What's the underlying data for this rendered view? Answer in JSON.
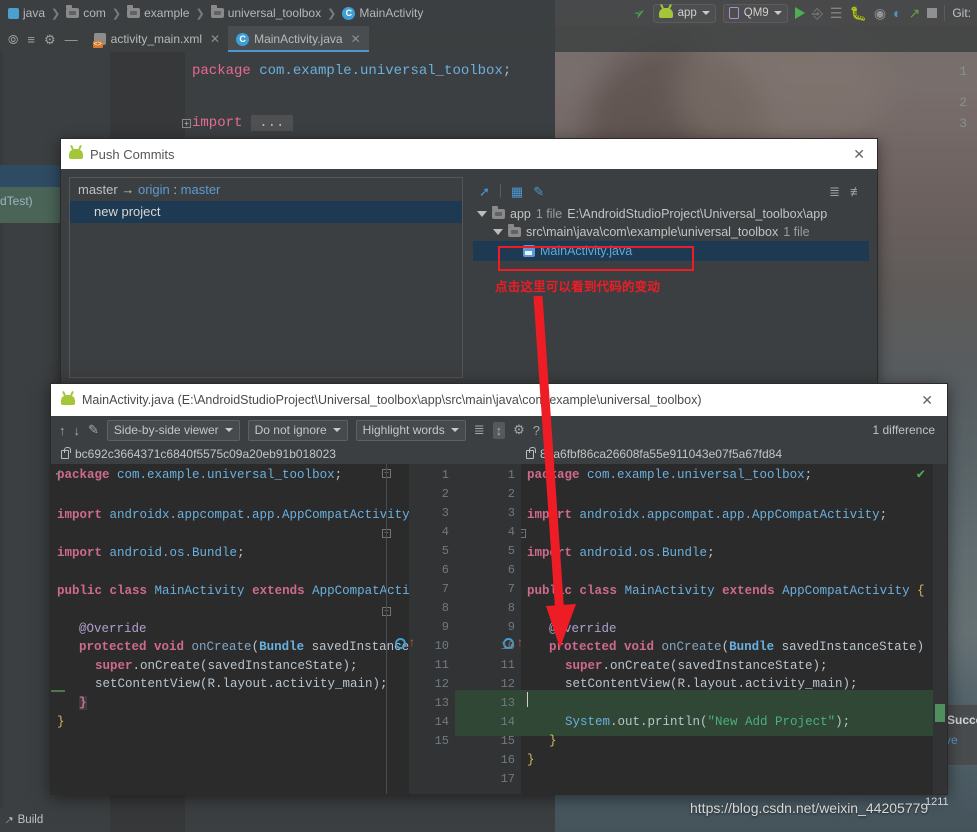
{
  "ide": {
    "breadcrumb": [
      {
        "label": "java",
        "icon": "folder-source-icon"
      },
      {
        "label": "com",
        "icon": "folder-icon"
      },
      {
        "label": "example",
        "icon": "folder-icon"
      },
      {
        "label": "universal_toolbox",
        "icon": "folder-icon"
      },
      {
        "label": "MainActivity",
        "icon": "class-icon"
      }
    ],
    "toolbar": {
      "module_selector": "app",
      "device_selector": "QM9",
      "git_label": "Git:",
      "icons": [
        "hammer-build-icon",
        "run-icon",
        "attach-debug-icon",
        "profile-list-icon",
        "debug-bug-icon",
        "run-coverage-icon",
        "profiler-icon",
        "sync-gradle-icon",
        "stop-icon"
      ]
    },
    "tabs": [
      {
        "label": "activity_main.xml",
        "icon": "xml-layout-icon",
        "active": false
      },
      {
        "label": "MainActivity.java",
        "icon": "class-icon",
        "active": true
      }
    ],
    "gutter_tools": [
      "target-icon",
      "collapse-icon",
      "settings-gear-icon",
      "minimize-icon"
    ],
    "editor_lines": [
      {
        "num": "1",
        "text": "package com.example.universal_toolbox;"
      },
      {
        "num": "2",
        "text": ""
      },
      {
        "num": "3",
        "text": "import ..."
      }
    ],
    "status_bar": {
      "build_label": "Build"
    },
    "background_labels": {
      "android_test": "dTest)"
    }
  },
  "push_dialog": {
    "title": "Push Commits",
    "title_icon": "android-icon",
    "close_label": "✕",
    "branch_line": {
      "local": "master",
      "arrow": "→",
      "remote": "origin",
      "sep": ":",
      "remote_branch": "master"
    },
    "commits": [
      "new project"
    ],
    "file_toolbar_icons": [
      "expand-diff-icon",
      "group-by-icon",
      "edit-icon",
      "expand-all-icon",
      "collapse-all-icon"
    ],
    "file_tree": [
      {
        "indent": 0,
        "name": "app",
        "count": "1 file",
        "path": "E:\\AndroidStudioProject\\Universal_toolbox\\app",
        "icon": "module-icon",
        "expanded": true
      },
      {
        "indent": 1,
        "name": "src\\main\\java\\com\\example\\universal_toolbox",
        "count": "1 file",
        "path": "",
        "icon": "folder-icon",
        "expanded": true
      },
      {
        "indent": 2,
        "name": "MainActivity.java",
        "count": "",
        "path": "",
        "icon": "java-file-icon",
        "selected": true
      }
    ],
    "annotation": {
      "text": "点击这里可以看到代码的变动",
      "color": "#ee1c25",
      "highlight_color": "#ee1c25"
    }
  },
  "diff_dialog": {
    "title": "MainActivity.java (E:\\AndroidStudioProject\\Universal_toolbox\\app\\src\\main\\java\\com\\example\\universal_toolbox)",
    "title_icon": "android-icon",
    "close_label": "✕",
    "toolbar": {
      "prev_diff_icon": "arrow-up-icon",
      "next_diff_icon": "arrow-down-icon",
      "edit_icon": "pencil-icon",
      "viewer_mode": "Side-by-side viewer",
      "ignore_mode": "Do not ignore",
      "highlight_mode": "Highlight words",
      "collapse_icon": "collapse-unchanged-icon",
      "expand_icon": "expand-selection-icon",
      "settings_icon": "gear-icon",
      "help_icon": "help-icon",
      "difference_count": "1 difference"
    },
    "revisions": {
      "left": "bc692c3664371c6840f5575c09a20eb91b018023",
      "right": "83a6fbf86ca26608fa55e911043e07f5a67fd84"
    },
    "left_lines": [
      {
        "num": "1",
        "text": "package com.example.universal_toolbox;"
      },
      {
        "num": "2",
        "text": ""
      },
      {
        "num": "3",
        "text": "import androidx.appcompat.app.AppCompatActivity;"
      },
      {
        "num": "4",
        "text": ""
      },
      {
        "num": "5",
        "text": "import android.os.Bundle;"
      },
      {
        "num": "6",
        "text": ""
      },
      {
        "num": "7",
        "text": "public class MainActivity extends AppCompatActivity {"
      },
      {
        "num": "8",
        "text": ""
      },
      {
        "num": "9",
        "text": "    @Override"
      },
      {
        "num": "10",
        "text": "    protected void onCreate(Bundle savedInstanceState) {"
      },
      {
        "num": "11",
        "text": "        super.onCreate(savedInstanceState);"
      },
      {
        "num": "12",
        "text": "        setContentView(R.layout.activity_main);"
      },
      {
        "num": "13",
        "text": "    }"
      },
      {
        "num": "14",
        "text": "}"
      },
      {
        "num": "15",
        "text": ""
      }
    ],
    "right_lines": [
      {
        "num": "1",
        "text": "package com.example.universal_toolbox;"
      },
      {
        "num": "2",
        "text": ""
      },
      {
        "num": "3",
        "text": "import androidx.appcompat.app.AppCompatActivity;"
      },
      {
        "num": "4",
        "text": ""
      },
      {
        "num": "5",
        "text": "import android.os.Bundle;"
      },
      {
        "num": "6",
        "text": ""
      },
      {
        "num": "7",
        "text": "public class MainActivity extends AppCompatActivity {"
      },
      {
        "num": "8",
        "text": ""
      },
      {
        "num": "9",
        "text": "    @Override"
      },
      {
        "num": "10",
        "text": "    protected void onCreate(Bundle savedInstanceState) {"
      },
      {
        "num": "11",
        "text": "        super.onCreate(savedInstanceState);"
      },
      {
        "num": "12",
        "text": "        setContentView(R.layout.activity_main);"
      },
      {
        "num": "13",
        "text": ""
      },
      {
        "num": "14",
        "text": "        System.out.println(\"New Add Project\");"
      },
      {
        "num": "15",
        "text": "    }"
      },
      {
        "num": "16",
        "text": "}"
      },
      {
        "num": "17",
        "text": ""
      }
    ]
  },
  "balloon": {
    "icon": "info-icon",
    "title": "Succe",
    "line": "Unive"
  },
  "watermark": {
    "url": "https://blog.csdn.net/weixin_44205779",
    "extra": "1211"
  },
  "colors": {
    "accent_blue": "#4a97d2",
    "selection_blue": "#1d3a52",
    "annotation_red": "#ee1c25",
    "added_green": "#2f4734",
    "dialog_bg": "#3c3f41",
    "editor_bg": "#2b2b2b"
  }
}
